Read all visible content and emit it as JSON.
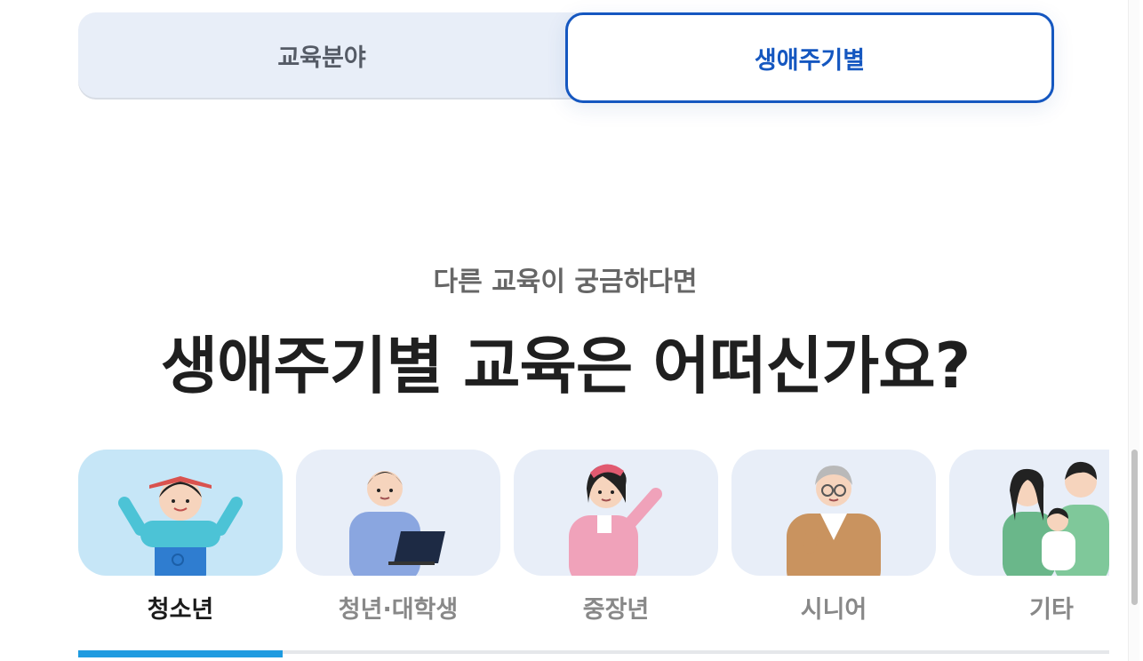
{
  "tabs": {
    "field_label": "교육분야",
    "lifecycle_label": "생애주기별"
  },
  "section": {
    "eyebrow": "다른 교육이 궁금하다면",
    "headline": "생애주기별 교육은 어떠신가요?"
  },
  "categories": [
    {
      "label": "청소년",
      "active": true
    },
    {
      "label": "청년·대학생",
      "active": false
    },
    {
      "label": "중장년",
      "active": false
    },
    {
      "label": "시니어",
      "active": false
    },
    {
      "label": "기타",
      "active": false
    }
  ],
  "colors": {
    "accent": "#1557c0",
    "indicator": "#1e9be0",
    "card_bg": "#e8eef8",
    "card_active_bg": "#c6e6f7"
  }
}
